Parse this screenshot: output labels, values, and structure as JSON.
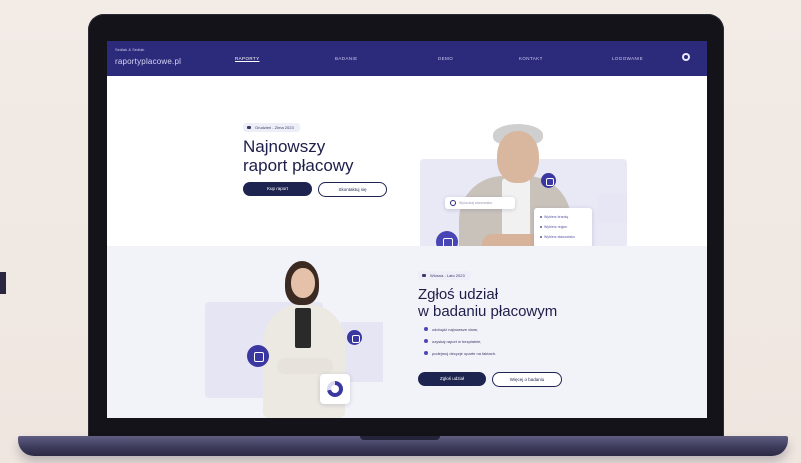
{
  "colors": {
    "nav_bg": "#2c2a7a",
    "primary_button": "#1e2450",
    "heading": "#1e1e4a",
    "accent": "#3a37a0",
    "section2_bg": "#f2f2f9"
  },
  "nav": {
    "brand_top": "Sedlak & Sedlak",
    "brand": "raportyplacowe.pl",
    "items": [
      "RAPORTY",
      "BADANIE",
      "DEMO",
      "KONTAKT",
      "LOGOWANIE"
    ],
    "active_index": 0,
    "user_icon": "user-icon"
  },
  "hero": {
    "date_chip": "Grudzień - Zima 2023",
    "title_line1": "Najnowszy",
    "title_line2": "raport płacowy",
    "primary_button": "Kup raport",
    "secondary_button": "Skontaktuj się",
    "search_placeholder": "Wyszukaj stanowisko",
    "list_items": [
      "Wybierz branżę",
      "Wybierz region",
      "Wybierz stanowisko"
    ],
    "icons": [
      "search-icon",
      "lightbulb-icon",
      "people-icon"
    ]
  },
  "survey": {
    "date_chip": "Wiosna - Lato 2023",
    "title_line1": "Zgłoś udział",
    "title_line2": "w badaniu płacowym",
    "bullets": [
      "zdobądź najnowsze dane,",
      "uzyskaj raport w bezpłatnie,",
      "podejmuj decyzje oparte na faktach."
    ],
    "primary_button": "Zgłoś udział",
    "secondary_button": "Więcej o badaniu",
    "icons": [
      "briefcase-icon",
      "gear-icon",
      "donut-chart-icon"
    ],
    "donut_fill_percent": 72
  }
}
